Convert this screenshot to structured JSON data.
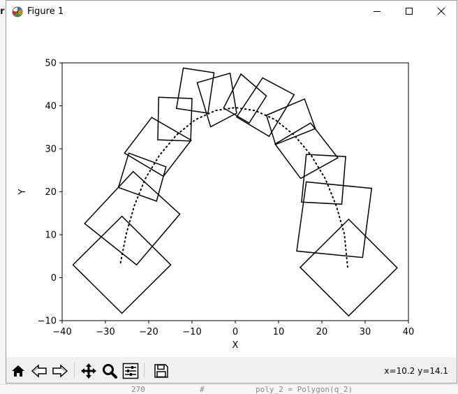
{
  "window": {
    "title": "Figure 1",
    "controls": [
      "minimize",
      "maximize",
      "close"
    ]
  },
  "background_app": {
    "left_edge_text": "r",
    "bottom_line": [
      "270",
      "#",
      "poly_2 = Polygon(q_2)"
    ]
  },
  "toolbar": {
    "items": [
      {
        "name": "home-button",
        "icon": "home-icon"
      },
      {
        "name": "back-button",
        "icon": "arrow-left-icon"
      },
      {
        "name": "forward-button",
        "icon": "arrow-right-icon"
      },
      {
        "name": "pan-button",
        "icon": "move-icon"
      },
      {
        "name": "zoom-button",
        "icon": "magnifier-icon"
      },
      {
        "name": "configure-subplots-button",
        "icon": "sliders-icon"
      },
      {
        "name": "save-button",
        "icon": "floppy-disk-icon"
      }
    ],
    "coordinates": "x=10.2 y=14.1"
  },
  "chart_data": {
    "type": "line",
    "title": "",
    "xlabel": "X",
    "ylabel": "Y",
    "xlim": [
      -40,
      40
    ],
    "ylim": [
      -10,
      50
    ],
    "xticks": [
      "−40",
      "−30",
      "−20",
      "−10",
      "0",
      "10",
      "20",
      "30",
      "40"
    ],
    "yticks": [
      "−10",
      "0",
      "10",
      "20",
      "30",
      "40",
      "50"
    ],
    "xtick_values": [
      -40,
      -30,
      -20,
      -10,
      0,
      10,
      20,
      30,
      40
    ],
    "ytick_values": [
      -10,
      0,
      10,
      20,
      30,
      40,
      50
    ],
    "grid": false,
    "path": {
      "style": "dotted",
      "color": "#000000",
      "x": [
        -26.5,
        -25.2,
        -23.3,
        -20.8,
        -17.5,
        -13.6,
        -9.2,
        -4.6,
        0,
        4.6,
        9.2,
        13.6,
        17.5,
        20.8,
        23.3,
        25.2,
        26
      ],
      "y": [
        3.5,
        10.2,
        16.8,
        23,
        28.5,
        33.2,
        36.8,
        38.9,
        39.6,
        38.9,
        36.8,
        33.2,
        28.5,
        23,
        16.8,
        10.2,
        2
      ]
    },
    "squares": [
      {
        "corners": [
          [
            -26.2,
            14.3
          ],
          [
            -37.5,
            3
          ],
          [
            -26.2,
            -8.3
          ],
          [
            -14.9,
            3
          ]
        ]
      },
      {
        "corners": [
          [
            -23.6,
            24.7
          ],
          [
            -34.8,
            12.6
          ],
          [
            -22.8,
            3
          ],
          [
            -12.8,
            14.8
          ]
        ]
      },
      {
        "corners": [
          [
            -24.6,
            29
          ],
          [
            -16,
            25.8
          ],
          [
            -18.2,
            17.8
          ],
          [
            -27,
            21
          ]
        ]
      },
      {
        "corners": [
          [
            -19.3,
            37.3
          ],
          [
            -25.6,
            29
          ],
          [
            -16.6,
            23.6
          ],
          [
            -10.2,
            32
          ]
        ]
      },
      {
        "corners": [
          [
            -17.7,
            42
          ],
          [
            -10,
            41.7
          ],
          [
            -10.3,
            31.8
          ],
          [
            -17.9,
            32.1
          ]
        ]
      },
      {
        "corners": [
          [
            -12,
            48.8
          ],
          [
            -4.9,
            47.7
          ],
          [
            -6.3,
            38.3
          ],
          [
            -13.6,
            39.4
          ]
        ]
      },
      {
        "corners": [
          [
            -8.8,
            45.4
          ],
          [
            -1.2,
            47.6
          ],
          [
            0.3,
            38.3
          ],
          [
            -5.7,
            35.1
          ]
        ]
      },
      {
        "corners": [
          [
            -2.7,
            39.5
          ],
          [
            1.3,
            47.4
          ],
          [
            7.2,
            42.3
          ],
          [
            3.2,
            36
          ]
        ]
      },
      {
        "corners": [
          [
            0.3,
            37.4
          ],
          [
            6.3,
            46.5
          ],
          [
            13.6,
            42.6
          ],
          [
            7.8,
            32.9
          ]
        ]
      },
      {
        "corners": [
          [
            7.2,
            37.8
          ],
          [
            16,
            41.6
          ],
          [
            18.5,
            34.7
          ],
          [
            9.3,
            31
          ]
        ]
      },
      {
        "corners": [
          [
            9.2,
            31.1
          ],
          [
            17.4,
            36
          ],
          [
            23.7,
            27.9
          ],
          [
            15.1,
            23.1
          ]
        ]
      },
      {
        "corners": [
          [
            16.4,
            28.7
          ],
          [
            25.5,
            28.2
          ],
          [
            24.6,
            17.1
          ],
          [
            15.3,
            17.6
          ]
        ]
      },
      {
        "corners": [
          [
            16.4,
            22.3
          ],
          [
            31.5,
            20.8
          ],
          [
            29.4,
            4.7
          ],
          [
            14.2,
            6.2
          ]
        ]
      },
      {
        "corners": [
          [
            26.2,
            13.6
          ],
          [
            37.4,
            2.3
          ],
          [
            26.2,
            -8.9
          ],
          [
            15,
            2.4
          ]
        ]
      }
    ]
  }
}
